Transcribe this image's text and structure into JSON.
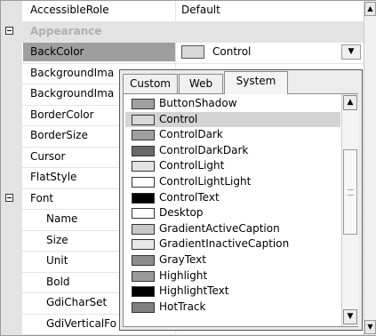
{
  "grid": {
    "rows": [
      {
        "name": "AccessibleRole",
        "value": "Default",
        "kind": "prop"
      },
      {
        "name": "Appearance",
        "value": "",
        "kind": "category"
      },
      {
        "name": "BackColor",
        "value": "Control",
        "kind": "selected"
      },
      {
        "name": "BackgroundIma",
        "value": "",
        "kind": "prop"
      },
      {
        "name": "BackgroundIma",
        "value": "",
        "kind": "prop"
      },
      {
        "name": "BorderColor",
        "value": "",
        "kind": "prop"
      },
      {
        "name": "BorderSize",
        "value": "",
        "kind": "prop"
      },
      {
        "name": "Cursor",
        "value": "",
        "kind": "prop"
      },
      {
        "name": "FlatStyle",
        "value": "",
        "kind": "prop"
      },
      {
        "name": "Font",
        "value": "",
        "kind": "expander"
      },
      {
        "name": "Name",
        "value": "",
        "kind": "sub"
      },
      {
        "name": "Size",
        "value": "",
        "kind": "sub"
      },
      {
        "name": "Unit",
        "value": "",
        "kind": "sub"
      },
      {
        "name": "Bold",
        "value": "",
        "kind": "sub"
      },
      {
        "name": "GdiCharSet",
        "value": "",
        "kind": "sub"
      },
      {
        "name": "GdiVerticalFo",
        "value": "",
        "kind": "sub"
      }
    ]
  },
  "color_picker": {
    "tabs": [
      "Custom",
      "Web",
      "System"
    ],
    "active_tab": "System",
    "items": [
      {
        "label": "ButtonShadow",
        "color": "#a0a0a0"
      },
      {
        "label": "Control",
        "color": "#d8d8d8",
        "selected": true
      },
      {
        "label": "ControlDark",
        "color": "#a0a0a0"
      },
      {
        "label": "ControlDarkDark",
        "color": "#696969"
      },
      {
        "label": "ControlLight",
        "color": "#e3e3e3"
      },
      {
        "label": "ControlLightLight",
        "color": "#ffffff"
      },
      {
        "label": "ControlText",
        "color": "#000000"
      },
      {
        "label": "Desktop",
        "color": "#ffffff"
      },
      {
        "label": "GradientActiveCaption",
        "color": "#c8c8c8"
      },
      {
        "label": "GradientInactiveCaption",
        "color": "#e8e8e8"
      },
      {
        "label": "GrayText",
        "color": "#8d8d8d"
      },
      {
        "label": "Highlight",
        "color": "#9a9a9a"
      },
      {
        "label": "HighlightText",
        "color": "#000000"
      },
      {
        "label": "HotTrack",
        "color": "#808080"
      }
    ]
  }
}
